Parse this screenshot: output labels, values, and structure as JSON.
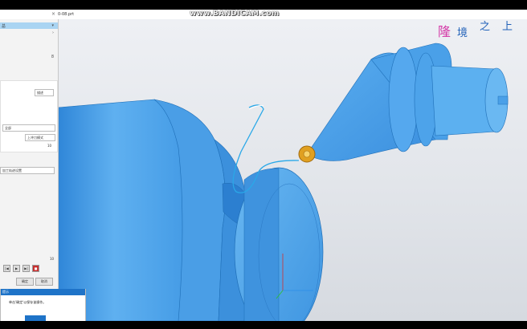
{
  "window": {
    "doc_title": "0-08.prt",
    "close_glyph": "×"
  },
  "watermark": "www.BANDICAM.com",
  "logo_text": [
    "隆",
    "境",
    "之",
    "上"
  ],
  "panel": {
    "selected_item_label": "总",
    "value_8": "8",
    "dropdown_1": "描述",
    "dropdown_2": "全部",
    "dropdown_3": "上冲刀模式",
    "value_10a": "10",
    "field_placeholder": "加工轨迹设置",
    "value_10b": "10",
    "btn_confirm": "确定",
    "btn_cancel": "取消",
    "play_icons": [
      "|◀",
      "▶",
      "▶|",
      "■"
    ]
  },
  "popup": {
    "header": "提示",
    "message": "单击'确定'以保存该操作。"
  },
  "colors": {
    "part_blue": "#4da3ea",
    "part_dark": "#2c7fd0",
    "tool_gold": "#e0a020",
    "toolpath": "#2aa8e8",
    "highlight": "#a9d4f2"
  }
}
